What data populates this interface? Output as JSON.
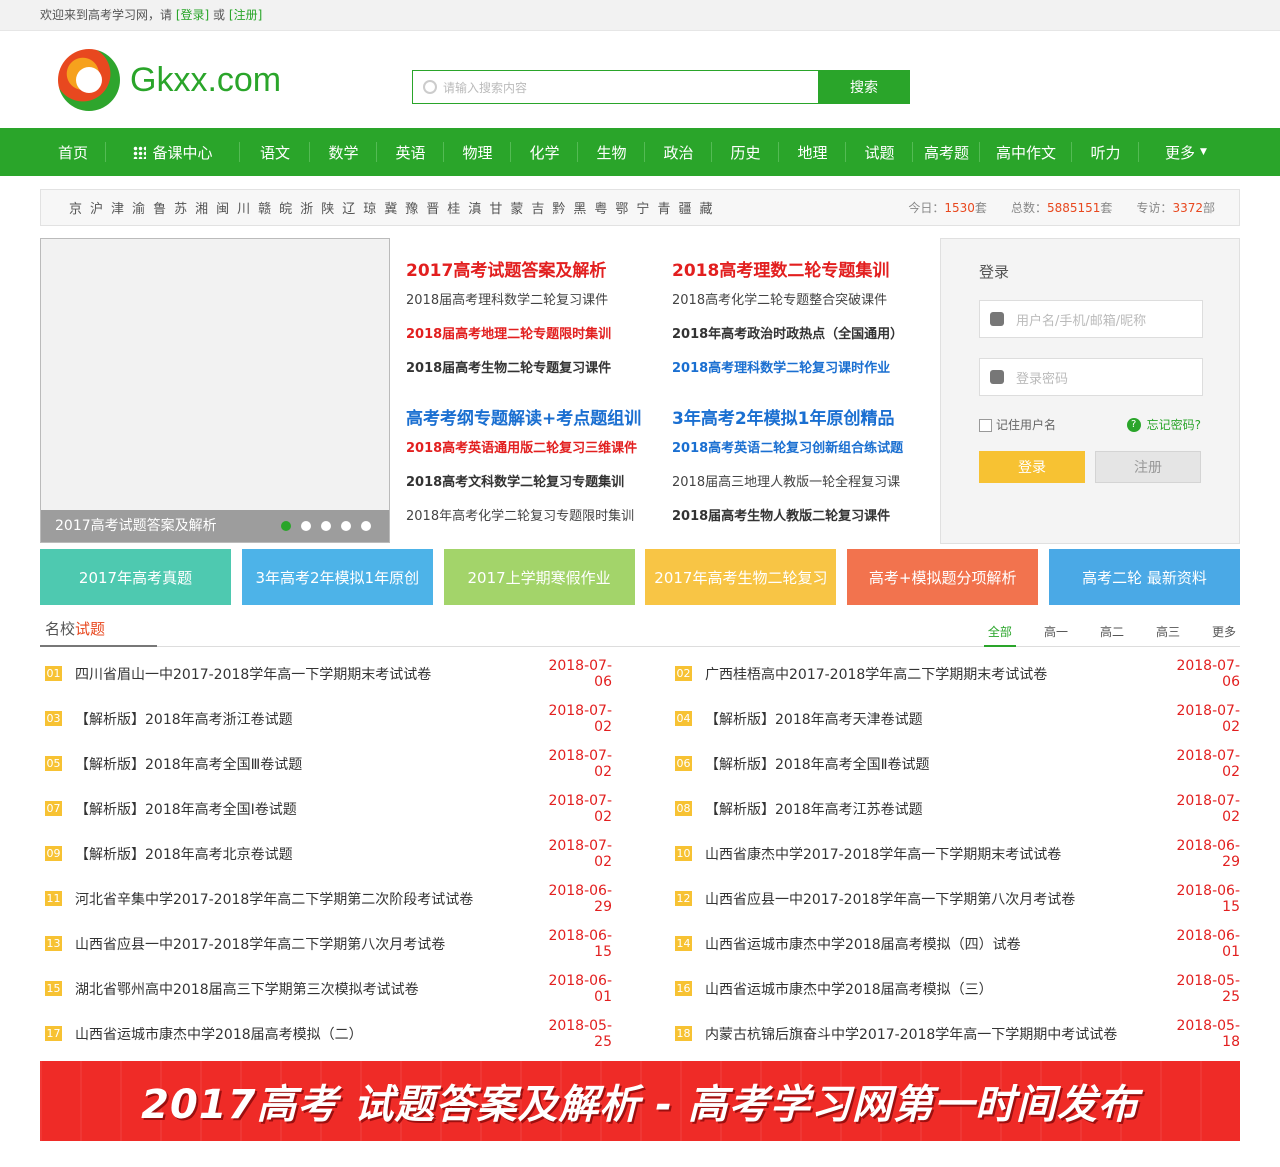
{
  "topbar": {
    "welcome": "欢迎来到高考学习网，请",
    "login": "[登录]",
    "or": "或",
    "register": "[注册]"
  },
  "header": {
    "logo_text": "Gkxx.com",
    "search_placeholder": "请输入搜索内容",
    "search_button": "搜索"
  },
  "nav": [
    {
      "label": "首页"
    },
    {
      "label": "备课中心"
    },
    {
      "label": "语文"
    },
    {
      "label": "数学"
    },
    {
      "label": "英语"
    },
    {
      "label": "物理"
    },
    {
      "label": "化学"
    },
    {
      "label": "生物"
    },
    {
      "label": "政治"
    },
    {
      "label": "历史"
    },
    {
      "label": "地理"
    },
    {
      "label": "试题"
    },
    {
      "label": "高考题"
    },
    {
      "label": "高中作文"
    },
    {
      "label": "听力"
    },
    {
      "label": "更多"
    }
  ],
  "provinces": [
    "京",
    "沪",
    "津",
    "渝",
    "鲁",
    "苏",
    "湘",
    "闽",
    "川",
    "赣",
    "皖",
    "浙",
    "陕",
    "辽",
    "琼",
    "冀",
    "豫",
    "晋",
    "桂",
    "滇",
    "甘",
    "蒙",
    "吉",
    "黔",
    "黑",
    "粤",
    "鄂",
    "宁",
    "青",
    "疆",
    "藏"
  ],
  "stats": [
    {
      "label": "今日：",
      "value": "1530",
      "unit": "套"
    },
    {
      "label": "总数：",
      "value": "5885151",
      "unit": "套"
    },
    {
      "label": "专访：",
      "value": "3372",
      "unit": "部"
    }
  ],
  "banner": {
    "caption": "2017高考试题答案及解析"
  },
  "featured": {
    "col1": {
      "head1": "2017高考试题答案及解析",
      "items1": [
        "2018届高考理科数学二轮复习课件",
        "2018届高考地理二轮专题限时集训",
        "2018届高考生物二轮专题复习课件"
      ],
      "head2": "高考考纲专题解读+考点题组训",
      "items2": [
        "2018高考英语通用版二轮复习三维课件",
        "2018高考文科数学二轮复习专题集训",
        "2018年高考化学二轮复习专题限时集训"
      ]
    },
    "col2": {
      "head1": "2018高考理数二轮专题集训",
      "items1": [
        "2018高考化学二轮专题整合突破课件",
        "2018年高考政治时政热点（全国通用）",
        "2018高考理科数学二轮复习课时作业"
      ],
      "head2": "3年高考2年模拟1年原创精品",
      "items2": [
        "2018高考英语二轮复习创新组合练试题",
        "2018届高三地理人教版一轮全程复习课",
        "2018届高考生物人教版二轮复习课件"
      ]
    }
  },
  "login": {
    "title": "登录",
    "user_placeholder": "用户名/手机/邮箱/昵称",
    "pass_placeholder": "登录密码",
    "remember": "记住用户名",
    "forgot": "忘记密码?",
    "login_button": "登录",
    "register_button": "注册"
  },
  "tiles": [
    {
      "label": "2017年高考真题",
      "color": "#4ec9b0"
    },
    {
      "label": "3年高考2年模拟1年原创",
      "color": "#4db3e8"
    },
    {
      "label": "2017上学期寒假作业",
      "color": "#a3d46a"
    },
    {
      "label": "2017年高考生物二轮复习",
      "color": "#f8c545"
    },
    {
      "label": "高考+模拟题分项解析",
      "color": "#f2734e"
    },
    {
      "label": "高考二轮 最新资料",
      "color": "#4aa9e6"
    }
  ],
  "schools": {
    "title_a": "名校",
    "title_b": "试题",
    "tabs": [
      "全部",
      "高一",
      "高二",
      "高三",
      "更多"
    ],
    "items": [
      {
        "num": "01",
        "title": "四川省眉山一中2017-2018学年高一下学期期末考试试卷",
        "date": "2018-07-06"
      },
      {
        "num": "02",
        "title": "广西桂梧高中2017-2018学年高二下学期期末考试试卷",
        "date": "2018-07-06"
      },
      {
        "num": "03",
        "title": "【解析版】2018年高考浙江卷试题",
        "date": "2018-07-02"
      },
      {
        "num": "04",
        "title": "【解析版】2018年高考天津卷试题",
        "date": "2018-07-02"
      },
      {
        "num": "05",
        "title": "【解析版】2018年高考全国Ⅲ卷试题",
        "date": "2018-07-02"
      },
      {
        "num": "06",
        "title": "【解析版】2018年高考全国Ⅱ卷试题",
        "date": "2018-07-02"
      },
      {
        "num": "07",
        "title": "【解析版】2018年高考全国Ⅰ卷试题",
        "date": "2018-07-02"
      },
      {
        "num": "08",
        "title": "【解析版】2018年高考江苏卷试题",
        "date": "2018-07-02"
      },
      {
        "num": "09",
        "title": "【解析版】2018年高考北京卷试题",
        "date": "2018-07-02"
      },
      {
        "num": "10",
        "title": "山西省康杰中学2017-2018学年高一下学期期末考试试卷",
        "date": "2018-06-29"
      },
      {
        "num": "11",
        "title": "河北省辛集中学2017-2018学年高二下学期第二次阶段考试试卷",
        "date": "2018-06-29"
      },
      {
        "num": "12",
        "title": "山西省应县一中2017-2018学年高一下学期第八次月考试卷",
        "date": "2018-06-15"
      },
      {
        "num": "13",
        "title": "山西省应县一中2017-2018学年高二下学期第八次月考试卷",
        "date": "2018-06-15"
      },
      {
        "num": "14",
        "title": "山西省运城市康杰中学2018届高考模拟（四）试卷",
        "date": "2018-06-01"
      },
      {
        "num": "15",
        "title": "湖北省鄂州高中2018届高三下学期第三次模拟考试试卷",
        "date": "2018-06-01"
      },
      {
        "num": "16",
        "title": "山西省运城市康杰中学2018届高考模拟（三）",
        "date": "2018-05-25"
      },
      {
        "num": "17",
        "title": "山西省运城市康杰中学2018届高考模拟（二）",
        "date": "2018-05-25"
      },
      {
        "num": "18",
        "title": "内蒙古杭锦后旗奋斗中学2017-2018学年高一下学期期中考试试卷",
        "date": "2018-05-18"
      }
    ]
  },
  "promo": {
    "text": "2017高考 试题答案及解析 - 高考学习网第一时间发布"
  }
}
